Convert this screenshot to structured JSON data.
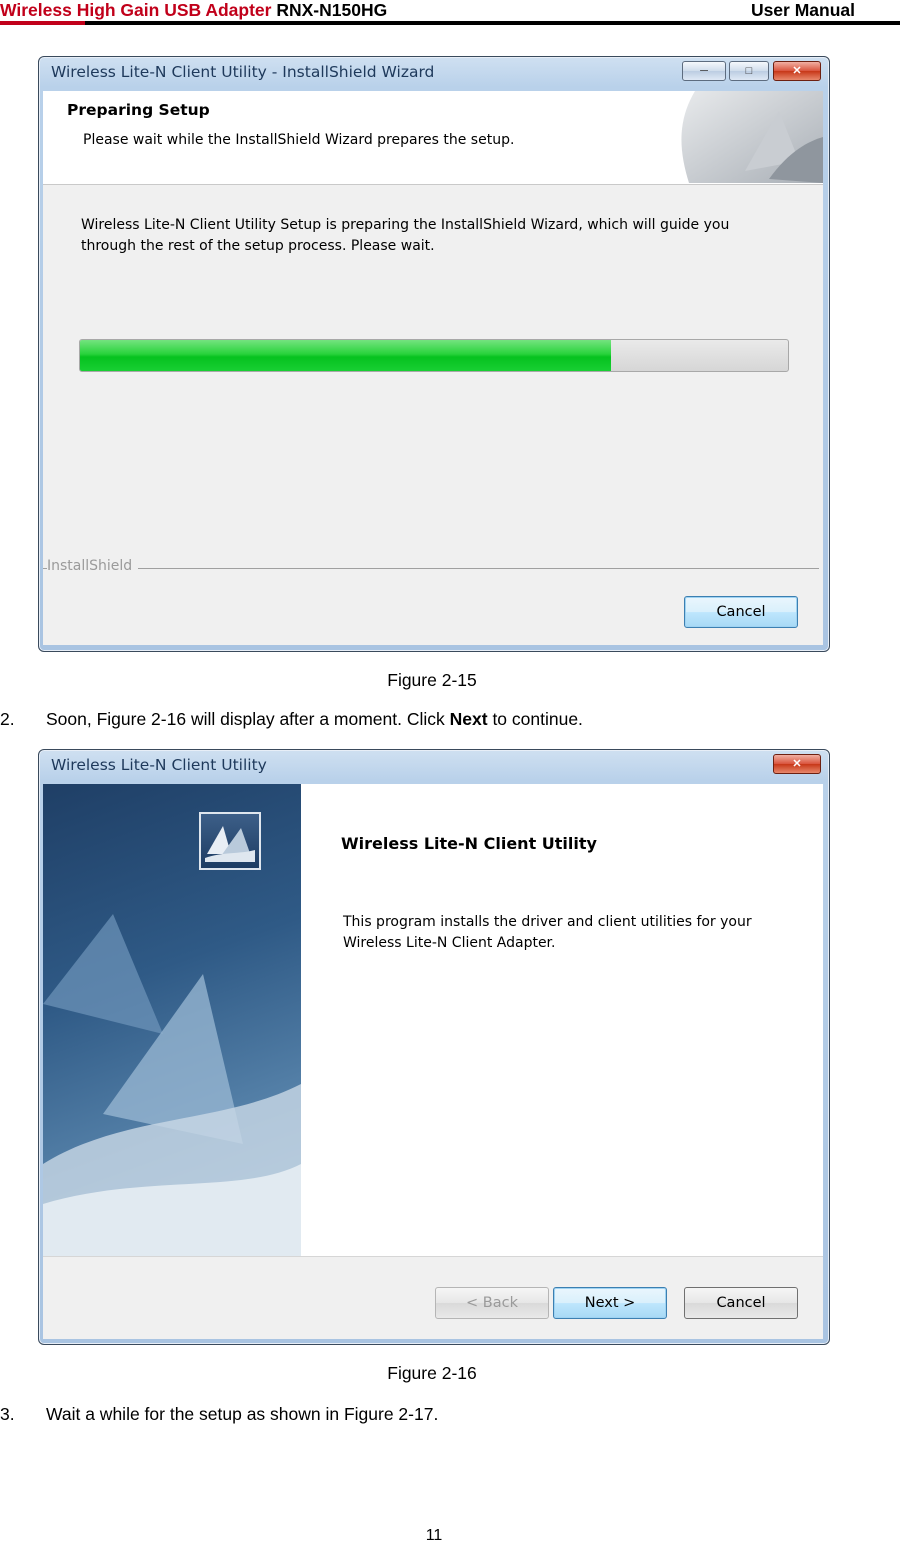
{
  "header": {
    "product_red": "Wireless High Gain USB Adapter",
    "model": "RNX-N150HG",
    "doc_type": "User Manual"
  },
  "figure1": {
    "window_title": "Wireless Lite-N Client Utility - InstallShield Wizard",
    "banner_title": "Preparing Setup",
    "banner_subtitle": "Please wait while the InstallShield Wizard prepares the setup.",
    "body_line1": "Wireless Lite-N Client Utility Setup is preparing the InstallShield Wizard, which will guide you",
    "body_line2": "through the rest of the setup process. Please wait.",
    "progress_fraction": 0.75,
    "footer_brand": "InstallShield",
    "cancel_label": "Cancel",
    "caption": "Figure 2-15"
  },
  "step2": {
    "number": "2.",
    "text_before": "Soon, Figure 2-16 will display after a moment. Click ",
    "bold": "Next",
    "text_after": " to continue."
  },
  "figure2": {
    "window_title": "Wireless Lite-N Client Utility",
    "app_title": "Wireless Lite-N Client Utility",
    "body_line1": "This program installs the driver and client utilities for your",
    "body_line2": "Wireless Lite-N Client Adapter.",
    "back_label": "< Back",
    "next_label": "Next >",
    "cancel_label": "Cancel",
    "caption": "Figure 2-16"
  },
  "step3": {
    "number": "3.",
    "text": "Wait a while for the setup as shown in Figure 2-17."
  },
  "page_number": "11"
}
